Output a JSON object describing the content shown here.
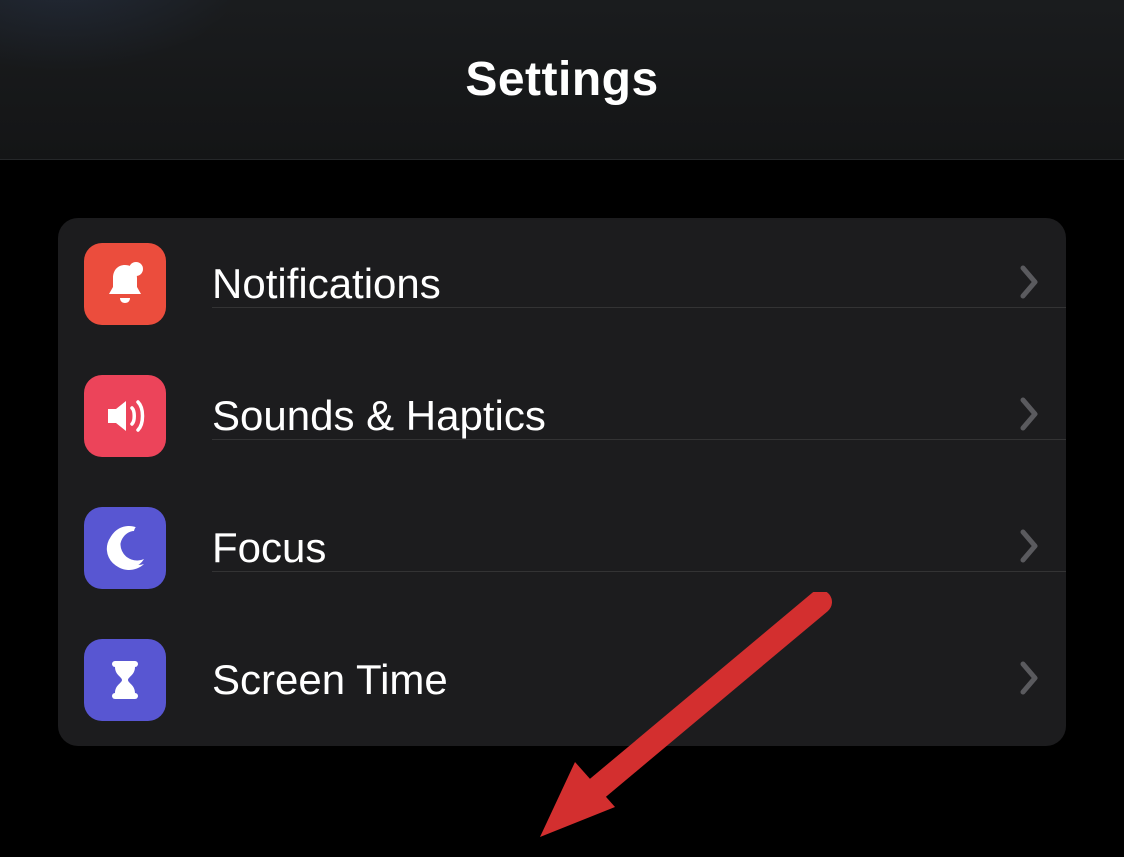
{
  "header": {
    "title": "Settings"
  },
  "group": {
    "items": [
      {
        "label": "Notifications",
        "icon": "bell-badge-icon",
        "color": "#eb4d3d"
      },
      {
        "label": "Sounds & Haptics",
        "icon": "speaker-icon",
        "color": "#ec445a"
      },
      {
        "label": "Focus",
        "icon": "moon-icon",
        "color": "#5856d2"
      },
      {
        "label": "Screen Time",
        "icon": "hourglass-icon",
        "color": "#5856d2"
      }
    ]
  },
  "annotation": {
    "type": "arrow",
    "target": "Screen Time",
    "color": "#d32f2f"
  }
}
